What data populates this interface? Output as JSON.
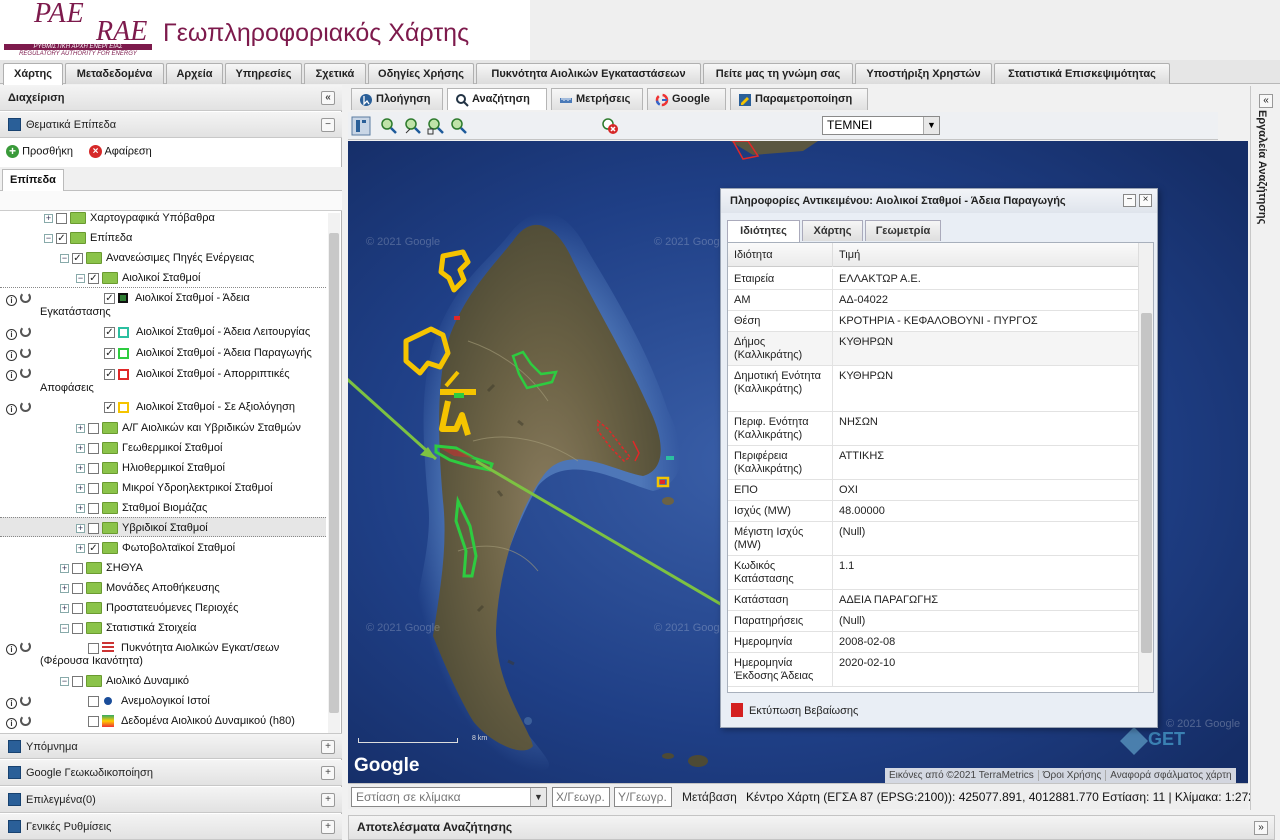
{
  "header": {
    "logo_primary": "PAE",
    "logo_secondary": "RAE",
    "logo_sub_el": "ΡΥΘΜΙΣΤΙΚΗ ΑΡΧΗ ΕΝΕΡΓΕΙΑΣ",
    "logo_sub_en": "REGULATORY AUTHORITY FOR ENERGY",
    "title": "Γεωπληροφοριακός Χάρτης",
    "brand_color": "#7d1a4c"
  },
  "main_tabs": [
    {
      "label": "Χάρτης",
      "active": true
    },
    {
      "label": "Μεταδεδομένα"
    },
    {
      "label": "Αρχεία"
    },
    {
      "label": "Υπηρεσίες"
    },
    {
      "label": "Σχετικά"
    },
    {
      "label": "Οδηγίες Χρήσης"
    },
    {
      "label": "Πυκνότητα Αιολικών Εγκαταστάσεων"
    },
    {
      "label": "Πείτε μας τη γνώμη σας"
    },
    {
      "label": "Υποστήριξη Χρηστών"
    },
    {
      "label": "Στατιστικά Επισκεψιμότητας"
    }
  ],
  "sidebar": {
    "title": "Διαχείριση",
    "collapse_glyph": "«",
    "thematic_title": "Θεματικά Επίπεδα",
    "add_label": "Προσθήκη",
    "remove_label": "Αφαίρεση",
    "layers_tab": "Επίπεδα",
    "tree": {
      "basemaps": "Χαρτογραφικά Υπόβαθρα",
      "layers": "Επίπεδα",
      "renewables": "Ανανεώσιμες Πηγές Ενέργειας",
      "wind": "Αιολικοί Σταθμοί",
      "wind_install_1": "Αιολικοί Σταθμοί - Άδεια",
      "wind_install_2": "Εγκατάστασης",
      "wind_operation": "Αιολικοί Σταθμοί - Άδεια Λειτουργίας",
      "wind_production": "Αιολικοί Σταθμοί - Άδεια Παραγωγής",
      "wind_rejected_1": "Αιολικοί Σταθμοί - Απορριπτικές",
      "wind_rejected_2": "Αποφάσεις",
      "wind_evaluation": "Αιολικοί Σταθμοί - Σε Αξιολόγηση",
      "hybrid_wind": "Α/Γ Αιολικών και Υβριδικών Σταθμών",
      "geothermal": "Γεωθερμικοί Σταθμοί",
      "solar_thermal": "Ηλιοθερμικοί Σταθμοί",
      "small_hydro": "Μικροί Υδροηλεκτρικοί Σταθμοί",
      "biomass": "Σταθμοί Βιομάζας",
      "hybrid": "Υβριδικοί Σταθμοί",
      "photovoltaic": "Φωτοβολταϊκοί Σταθμοί",
      "sithya": "ΣΗΘΥΑ",
      "storage": "Μονάδες Αποθήκευσης",
      "protected": "Προστατευόμενες Περιοχές",
      "statistics": "Στατιστικά Στοιχεία",
      "density_1": "Πυκνότητα Αιολικών Εγκατ/σεων",
      "density_2": "(Φέρουσα Ικανότητα)",
      "wind_potential": "Αιολικό Δυναμικό",
      "masts": "Ανεμολογικοί Ιστοί",
      "potential_data": "Δεδομένα Αιολικού Δυναμικού (h80)"
    },
    "bottom_panels": [
      "Υπόμνημα",
      "Google Γεωκωδικοποίηση",
      "Επιλεγμένα(0)",
      "Γενικές Ρυθμίσεις"
    ]
  },
  "map_tabs": [
    {
      "label": "Πλοήγηση",
      "icon": "navigation-icon"
    },
    {
      "label": "Αναζήτηση",
      "icon": "search-icon",
      "active": true
    },
    {
      "label": "Μετρήσεις",
      "icon": "ruler-icon"
    },
    {
      "label": "Google",
      "icon": "google-icon"
    },
    {
      "label": "Παραμετροποίηση",
      "icon": "settings-icon"
    }
  ],
  "toolbar": {
    "layer_value": "ΤΕΜΝΕΙ"
  },
  "map": {
    "google_logo": "Google",
    "watermark": "© 2021 Google",
    "scale_label": "8 km",
    "attribution_imagery": "Εικόνες από ©2021 TerraMetrics",
    "attribution_terms": "Όροι Χρήσης",
    "attribution_report": "Αναφορά σφάλματος χάρτη"
  },
  "status": {
    "scale_placeholder": "Εστίαση σε κλίμακα",
    "x_placeholder": "X/Γεωγρ.",
    "y_placeholder": "Y/Γεωγρ.",
    "goto_label": "Μετάβαση",
    "center_text": "Κέντρο Χάρτη (ΕΓΣΑ 87 (EPSG:2100)): 425077.891, 4012881.770 Εστίαση: 11 | Κλίμακα: 1:272989 |"
  },
  "results_title": "Αποτελέσματα Αναζήτησης",
  "right_panel_title": "Εργαλεία Αναζήτησης",
  "popup": {
    "title": "Πληροφορίες Αντικειμένου: Αιολικοί Σταθμοί - Άδεια Παραγωγής",
    "tabs": [
      "Ιδιότητες",
      "Χάρτης",
      "Γεωμετρία"
    ],
    "col_property": "Ιδιότητα",
    "col_value": "Τιμή",
    "rows": [
      {
        "key": "Εταιρεία",
        "value": "ΕΛΛΑΚΤΩΡ Α.Ε."
      },
      {
        "key": "ΑΜ",
        "value": "ΑΔ-04022"
      },
      {
        "key": "Θέση",
        "value": "ΚΡΟΤΗΡΙΑ - ΚΕΦΑΛΟΒΟΥΝΙ - ΠΥΡΓΟΣ"
      },
      {
        "key": "Δήμος (Καλλικράτης)",
        "value": "ΚΥΘΗΡΩΝ"
      },
      {
        "key": "Δημοτική Ενότητα (Καλλικράτης)",
        "value": "ΚΥΘΗΡΩΝ"
      },
      {
        "key": "Περιφ. Ενότητα (Καλλικράτης)",
        "value": "ΝΗΣΩΝ"
      },
      {
        "key": "Περιφέρεια (Καλλικράτης)",
        "value": "ΑΤΤΙΚΗΣ"
      },
      {
        "key": "ΕΠΟ",
        "value": "ΟΧΙ"
      },
      {
        "key": "Ισχύς (MW)",
        "value": "48.00000"
      },
      {
        "key": "Μέγιστη Ισχύς (MW)",
        "value": "(Null)"
      },
      {
        "key": "Κωδικός Κατάστασης",
        "value": "1.1"
      },
      {
        "key": "Κατάσταση",
        "value": "ΑΔΕΙΑ ΠΑΡΑΓΩΓΗΣ"
      },
      {
        "key": "Παρατηρήσεις",
        "value": "(Null)"
      },
      {
        "key": "Ημερομηνία",
        "value": "2008-02-08"
      },
      {
        "key": "Ημερομηνία Έκδοσης Άδειας",
        "value": "2020-02-10"
      }
    ],
    "print_label": "Εκτύπωση Βεβαίωσης"
  },
  "colors": {
    "accent_green_arrow": "#7dc242",
    "layer_yellow": "#f5c400",
    "layer_green": "#2ecc40",
    "layer_red": "#e02828"
  }
}
